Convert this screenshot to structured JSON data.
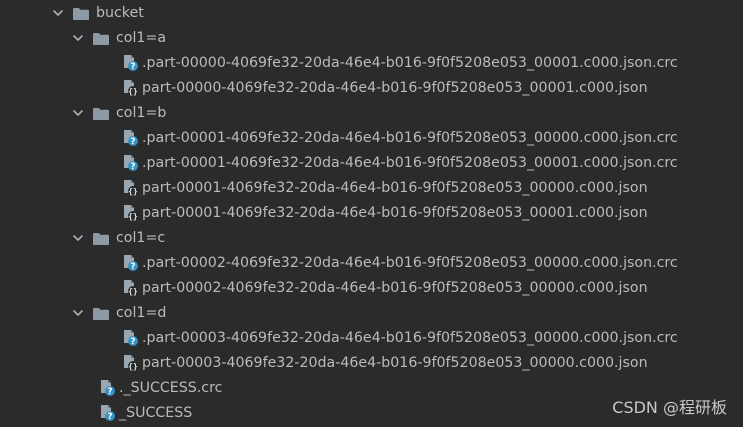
{
  "tree": {
    "root": {
      "label": "bucket",
      "icon": "folder-icon",
      "expanded": true
    },
    "folders": [
      {
        "label": "col1=a",
        "icon": "folder-icon",
        "expanded": true,
        "files": [
          {
            "label": ".part-00000-4069fe32-20da-46e4-b016-9f0f5208e053_00001.c000.json.crc",
            "icon": "unknown-file-icon"
          },
          {
            "label": "part-00000-4069fe32-20da-46e4-b016-9f0f5208e053_00001.c000.json",
            "icon": "json-file-icon"
          }
        ]
      },
      {
        "label": "col1=b",
        "icon": "folder-icon",
        "expanded": true,
        "files": [
          {
            "label": ".part-00001-4069fe32-20da-46e4-b016-9f0f5208e053_00000.c000.json.crc",
            "icon": "unknown-file-icon"
          },
          {
            "label": ".part-00001-4069fe32-20da-46e4-b016-9f0f5208e053_00001.c000.json.crc",
            "icon": "unknown-file-icon"
          },
          {
            "label": "part-00001-4069fe32-20da-46e4-b016-9f0f5208e053_00000.c000.json",
            "icon": "json-file-icon"
          },
          {
            "label": "part-00001-4069fe32-20da-46e4-b016-9f0f5208e053_00001.c000.json",
            "icon": "json-file-icon"
          }
        ]
      },
      {
        "label": "col1=c",
        "icon": "folder-icon",
        "expanded": true,
        "files": [
          {
            "label": ".part-00002-4069fe32-20da-46e4-b016-9f0f5208e053_00000.c000.json.crc",
            "icon": "unknown-file-icon"
          },
          {
            "label": "part-00002-4069fe32-20da-46e4-b016-9f0f5208e053_00000.c000.json",
            "icon": "json-file-icon"
          }
        ]
      },
      {
        "label": "col1=d",
        "icon": "folder-icon",
        "expanded": true,
        "files": [
          {
            "label": ".part-00003-4069fe32-20da-46e4-b016-9f0f5208e053_00000.c000.json.crc",
            "icon": "unknown-file-icon"
          },
          {
            "label": "part-00003-4069fe32-20da-46e4-b016-9f0f5208e053_00000.c000.json",
            "icon": "json-file-icon"
          }
        ]
      }
    ],
    "root_files": [
      {
        "label": "._SUCCESS.crc",
        "icon": "unknown-file-icon"
      },
      {
        "label": "_SUCCESS",
        "icon": "unknown-file-icon"
      }
    ]
  },
  "watermark": "CSDN @程研板",
  "colors": {
    "background": "#2b2b2b",
    "text": "#bbbbbb",
    "folder": "#8d9aa6",
    "file_body": "#9aa7b0",
    "help_badge": "#3592c4",
    "json_badge": "#d9dfe3"
  }
}
